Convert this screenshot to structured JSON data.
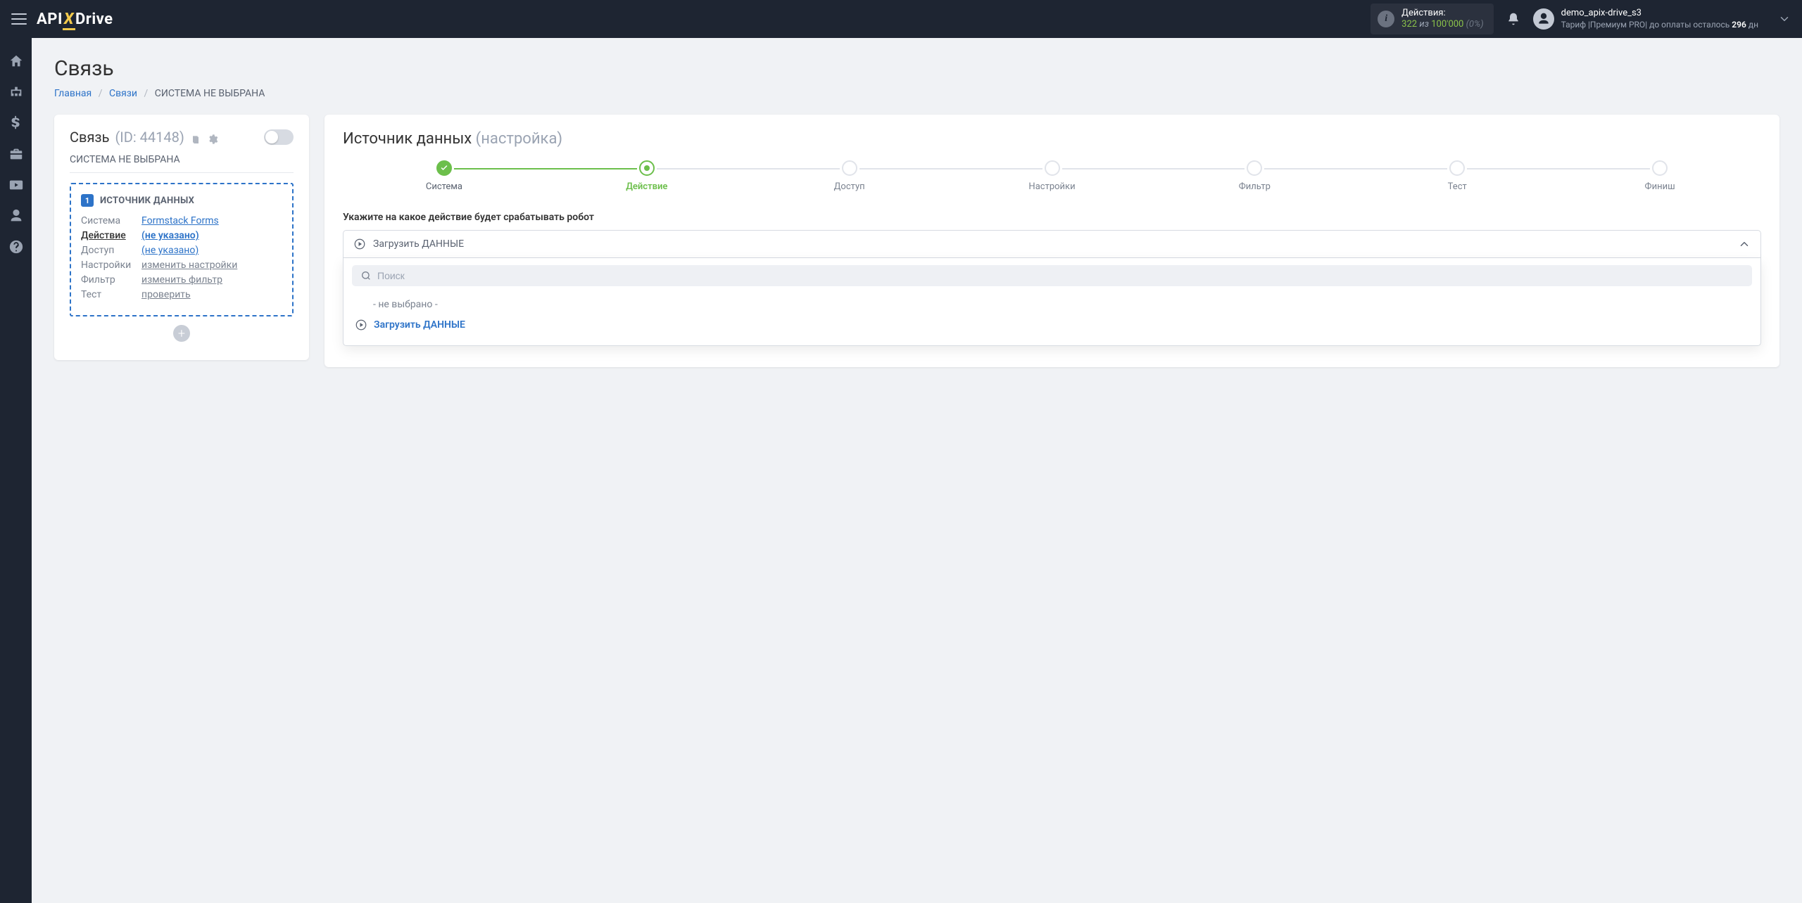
{
  "topbar": {
    "actions_label": "Действия:",
    "actions_count": "322",
    "actions_of": "из",
    "actions_total": "100'000",
    "actions_pct": "(0%)",
    "username": "demo_apix-drive_s3",
    "tariff_prefix": "Тариф |Премиум PRO| до оплаты осталось",
    "tariff_days": "296",
    "tariff_suffix": "дн"
  },
  "breadcrumb": {
    "home": "Главная",
    "links": "Связи",
    "current": "СИСТЕМА НЕ ВЫБРАНА"
  },
  "page": {
    "title": "Связь"
  },
  "left_card": {
    "title": "Связь",
    "id_label": "(ID: 44148)",
    "subtitle": "СИСТЕМА НЕ ВЫБРАНА",
    "source_badge": "1",
    "source_title": "ИСТОЧНИК ДАННЫХ",
    "rows": {
      "system_k": "Система",
      "system_v": "Formstack Forms",
      "action_k": "Действие",
      "action_v": "(не указано)",
      "access_k": "Доступ",
      "access_v": "(не указано)",
      "settings_k": "Настройки",
      "settings_v": "изменить настройки",
      "filter_k": "Фильтр",
      "filter_v": "изменить фильтр",
      "test_k": "Тест",
      "test_v": "проверить"
    }
  },
  "right_card": {
    "title_main": "Источник данных",
    "title_sub": "(настройка)",
    "steps": {
      "s1": "Система",
      "s2": "Действие",
      "s3": "Доступ",
      "s4": "Настройки",
      "s5": "Фильтр",
      "s6": "Тест",
      "s7": "Финиш"
    },
    "form_label": "Укажите на какое действие будет срабатывать робот",
    "select_value": "Загрузить ДАННЫЕ",
    "search_placeholder": "Поиск",
    "opt_none": "- не выбрано -",
    "opt_load": "Загрузить ДАННЫЕ"
  }
}
